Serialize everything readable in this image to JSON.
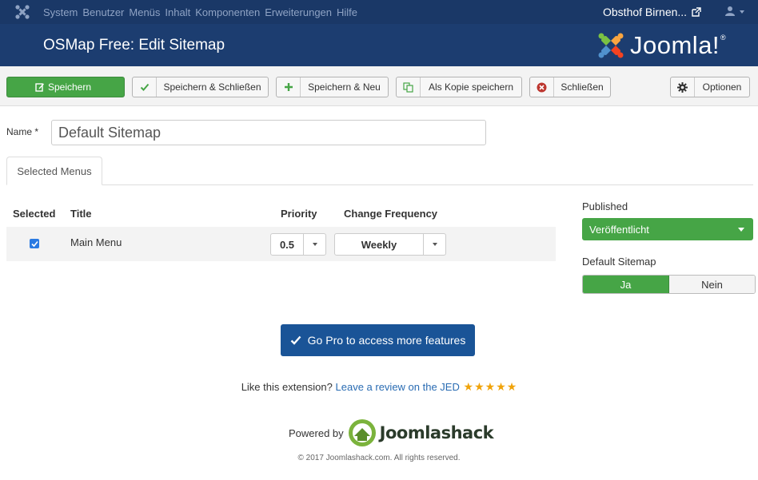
{
  "topbar": {
    "menu": [
      "System",
      "Benutzer",
      "Menüs",
      "Inhalt",
      "Komponenten",
      "Erweiterungen",
      "Hilfe"
    ],
    "site_name": "Obsthof Birnen..."
  },
  "header": {
    "title": "OSMap Free: Edit Sitemap",
    "brand": "Joomla!"
  },
  "toolbar": {
    "save": "Speichern",
    "save_close": "Speichern & Schließen",
    "save_new": "Speichern & Neu",
    "save_copy": "Als Kopie speichern",
    "close": "Schließen",
    "options": "Optionen"
  },
  "form": {
    "name_label": "Name *",
    "name_value": "Default Sitemap"
  },
  "tabs": [
    "Selected Menus"
  ],
  "table": {
    "headers": {
      "selected": "Selected",
      "title": "Title",
      "priority": "Priority",
      "frequency": "Change Frequency"
    },
    "rows": [
      {
        "selected": true,
        "title": "Main Menu",
        "priority": "0.5",
        "frequency": "Weekly"
      }
    ]
  },
  "sidebar": {
    "published_label": "Published",
    "published_value": "Veröffentlicht",
    "default_label": "Default Sitemap",
    "default_yes": "Ja",
    "default_no": "Nein"
  },
  "promo": {
    "pro_button": "Go Pro to access more features",
    "review_prefix": "Like this extension?",
    "review_link": "Leave a review on the JED",
    "stars": 5,
    "powered_by": "Powered by",
    "powered_brand": "Joomlashack",
    "copyright": "© 2017 Joomlashack.com. All rights reserved."
  },
  "colors": {
    "navbar": "#1a3867",
    "header": "#1c3d70",
    "success": "#46a546",
    "primary": "#1a5497",
    "star": "#f0a30a"
  },
  "icons": {
    "save": "edit-icon",
    "save_close": "check-icon",
    "save_new": "plus-icon",
    "save_copy": "copy-icon",
    "close": "cancel-circle-icon",
    "options": "gear-icon"
  }
}
